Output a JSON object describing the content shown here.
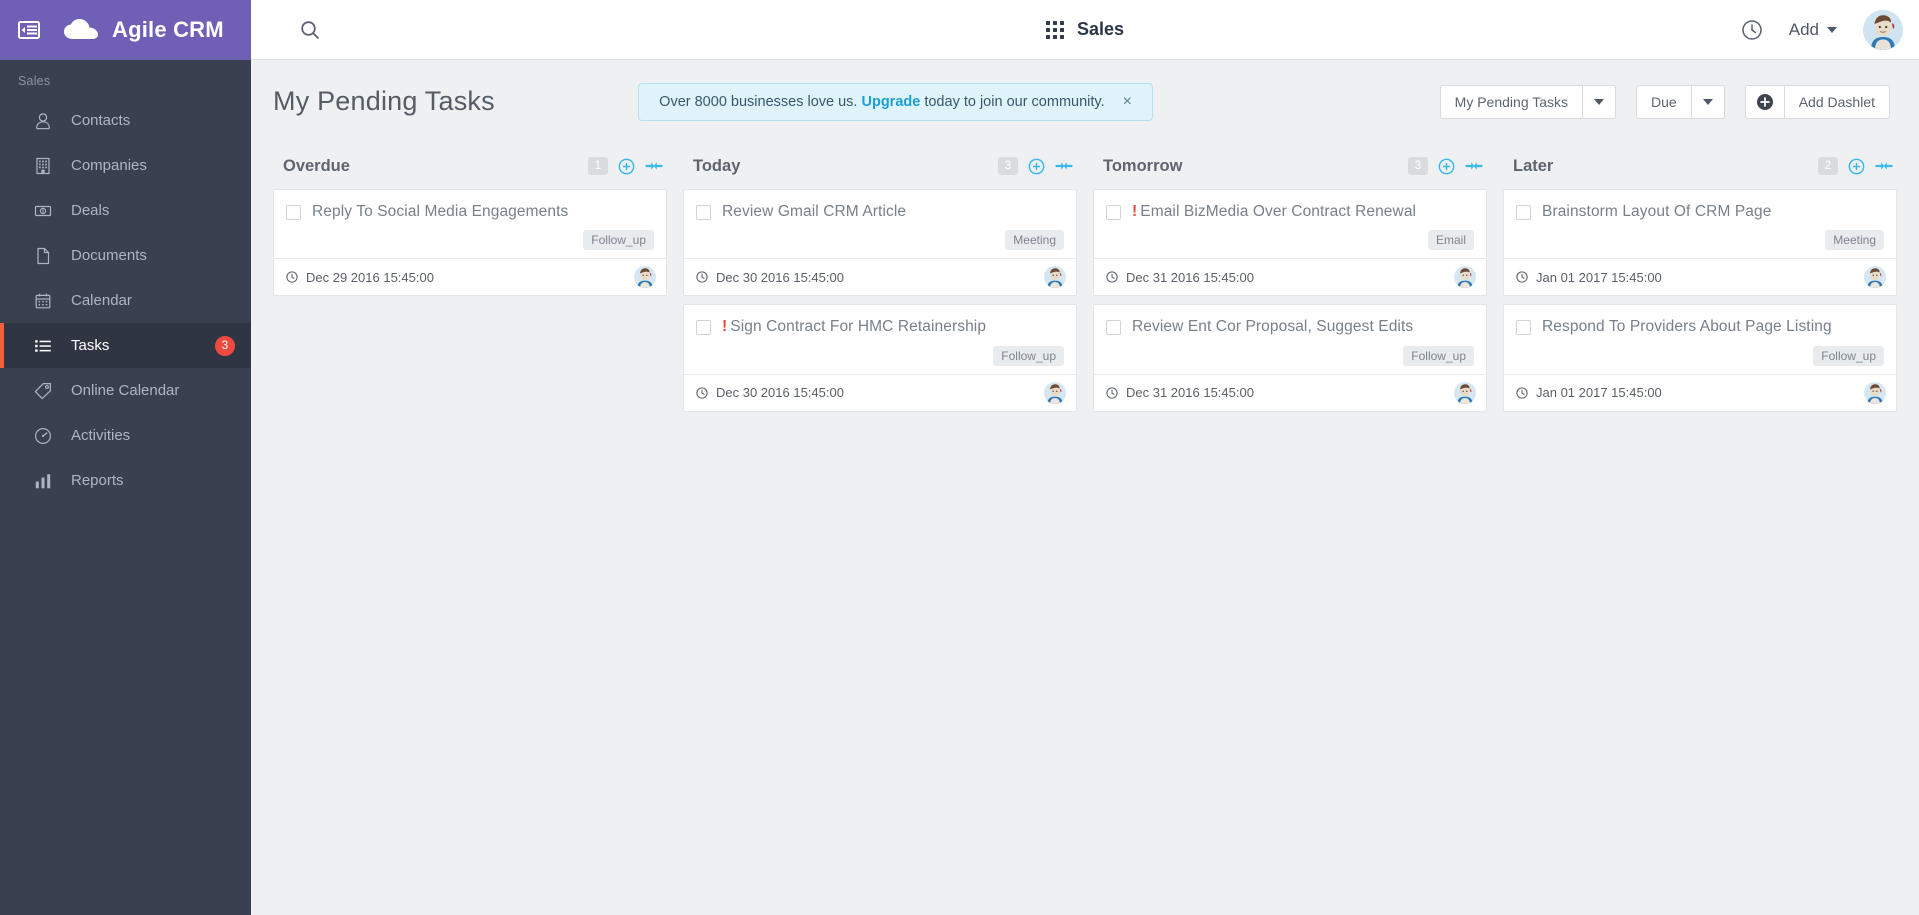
{
  "brand": {
    "name": "Agile CRM",
    "toggle_icon": "sidebar-toggle-icon",
    "logo_icon": "cloud-icon"
  },
  "sidebar": {
    "section_label": "Sales",
    "items": [
      {
        "label": "Contacts",
        "icon": "user-icon",
        "active": false,
        "badge": ""
      },
      {
        "label": "Companies",
        "icon": "building-icon",
        "active": false,
        "badge": ""
      },
      {
        "label": "Deals",
        "icon": "money-icon",
        "active": false,
        "badge": ""
      },
      {
        "label": "Documents",
        "icon": "document-icon",
        "active": false,
        "badge": ""
      },
      {
        "label": "Calendar",
        "icon": "calendar-icon",
        "active": false,
        "badge": ""
      },
      {
        "label": "Tasks",
        "icon": "list-icon",
        "active": true,
        "badge": "3"
      },
      {
        "label": "Online Calendar",
        "icon": "tag-icon",
        "active": false,
        "badge": ""
      },
      {
        "label": "Activities",
        "icon": "speedometer-icon",
        "active": false,
        "badge": ""
      },
      {
        "label": "Reports",
        "icon": "bar-chart-icon",
        "active": false,
        "badge": ""
      }
    ]
  },
  "topbar": {
    "search_icon": "search-icon",
    "apps_icon": "grid-apps-icon",
    "title": "Sales",
    "clock_icon": "clock-icon",
    "add_label": "Add",
    "avatar_name": "user-avatar"
  },
  "page": {
    "title": "My Pending Tasks"
  },
  "promo": {
    "text_before": "Over 8000 businesses love us.",
    "link": "Upgrade",
    "text_after": "today to join our community.",
    "close_label": "×"
  },
  "toolbar": {
    "view_filter": "My Pending Tasks",
    "sort_filter": "Due",
    "add_dashlet_label": "Add Dashlet",
    "add_dashlet_icon": "plus-circle-icon",
    "caret_icon": "chevron-down-icon"
  },
  "board": {
    "columns": [
      {
        "title": "Overdue",
        "count": "1",
        "add_icon": "plus-circle-icon",
        "collapse_icon": "collapse-arrows-icon",
        "tasks": [
          {
            "title": "Reply To Social Media Engagements",
            "priority": "",
            "tag": "Follow_up",
            "date": "Dec 29 2016 15:45:00",
            "clock_icon": "clock-icon",
            "avatar_name": "task-owner-avatar"
          }
        ]
      },
      {
        "title": "Today",
        "count": "3",
        "add_icon": "plus-circle-icon",
        "collapse_icon": "collapse-arrows-icon",
        "tasks": [
          {
            "title": "Review Gmail CRM Article",
            "priority": "",
            "tag": "Meeting",
            "date": "Dec 30 2016 15:45:00",
            "clock_icon": "clock-icon",
            "avatar_name": "task-owner-avatar"
          },
          {
            "title": "Sign Contract For HMC Retainership",
            "priority": "!",
            "tag": "Follow_up",
            "date": "Dec 30 2016 15:45:00",
            "clock_icon": "clock-icon",
            "avatar_name": "task-owner-avatar"
          }
        ]
      },
      {
        "title": "Tomorrow",
        "count": "3",
        "add_icon": "plus-circle-icon",
        "collapse_icon": "collapse-arrows-icon",
        "tasks": [
          {
            "title": "Email BizMedia Over Contract Renewal",
            "priority": "!",
            "tag": "Email",
            "date": "Dec 31 2016 15:45:00",
            "clock_icon": "clock-icon",
            "avatar_name": "task-owner-avatar"
          },
          {
            "title": "Review Ent Cor Proposal, Suggest Edits",
            "priority": "",
            "tag": "Follow_up",
            "date": "Dec 31 2016 15:45:00",
            "clock_icon": "clock-icon",
            "avatar_name": "task-owner-avatar"
          }
        ]
      },
      {
        "title": "Later",
        "count": "2",
        "add_icon": "plus-circle-icon",
        "collapse_icon": "collapse-arrows-icon",
        "tasks": [
          {
            "title": "Brainstorm Layout Of CRM Page",
            "priority": "",
            "tag": "Meeting",
            "date": "Jan 01 2017 15:45:00",
            "clock_icon": "clock-icon",
            "avatar_name": "task-owner-avatar"
          },
          {
            "title": "Respond To Providers About Page Listing",
            "priority": "",
            "tag": "Follow_up",
            "date": "Jan 01 2017 15:45:00",
            "clock_icon": "clock-icon",
            "avatar_name": "task-owner-avatar"
          }
        ]
      }
    ]
  },
  "colors": {
    "brand_purple": "#6f5fb5",
    "sidebar_dark": "#39404f",
    "sidebar_active": "#2f3542",
    "accent_orange": "#f2603c",
    "badge_red": "#ef4a41",
    "column_icon_blue": "#37b8ec",
    "promo_bg": "#dff3fb",
    "promo_link": "#1ba0d6",
    "priority_red": "#e8453c",
    "page_bg": "#eef0f2"
  }
}
